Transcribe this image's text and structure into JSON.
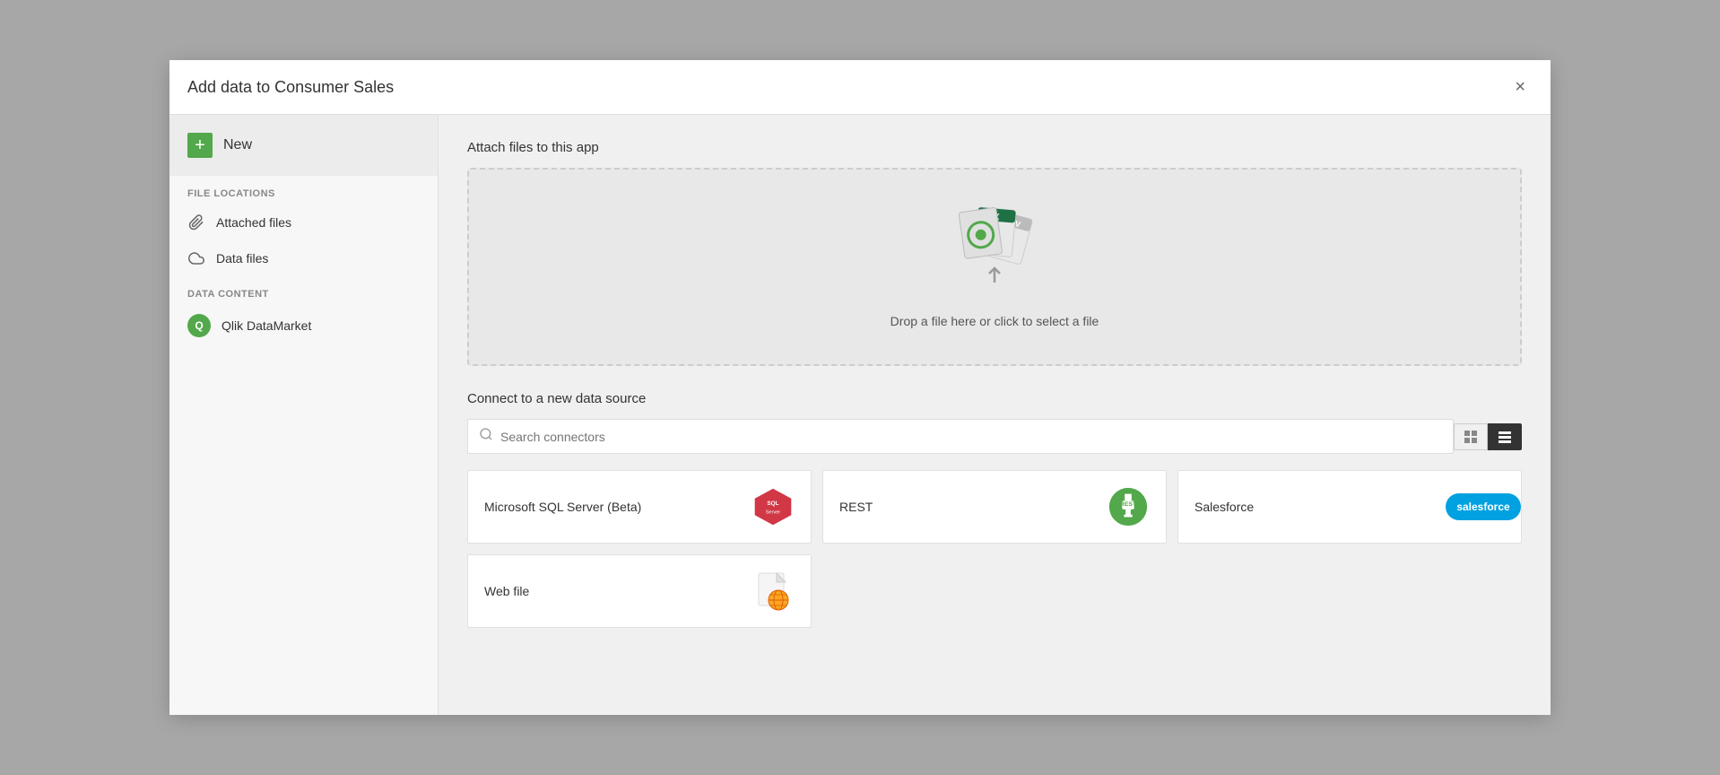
{
  "modal": {
    "title": "Add data to Consumer Sales",
    "close_label": "×"
  },
  "sidebar": {
    "new_label": "New",
    "file_locations_label": "FILE LOCATIONS",
    "items_file": [
      {
        "id": "attached-files",
        "label": "Attached files",
        "icon": "paperclip"
      },
      {
        "id": "data-files",
        "label": "Data files",
        "icon": "cloud"
      }
    ],
    "data_content_label": "DATA CONTENT",
    "items_data": [
      {
        "id": "qlik-datamarket",
        "label": "Qlik DataMarket",
        "icon": "datamarket"
      }
    ]
  },
  "main": {
    "attach_title": "Attach files to this app",
    "drop_text": "Drop a file here or click to select a file",
    "connect_title": "Connect to a new data source",
    "search_placeholder": "Search connectors",
    "view_grid_label": "⊞",
    "view_list_label": "≡",
    "connectors": [
      {
        "id": "mssql",
        "name": "Microsoft SQL Server (Beta)",
        "logo_type": "sql"
      },
      {
        "id": "rest",
        "name": "REST",
        "logo_type": "rest"
      },
      {
        "id": "salesforce",
        "name": "Salesforce",
        "logo_type": "salesforce"
      },
      {
        "id": "webfile",
        "name": "Web file",
        "logo_type": "webfile"
      }
    ]
  }
}
